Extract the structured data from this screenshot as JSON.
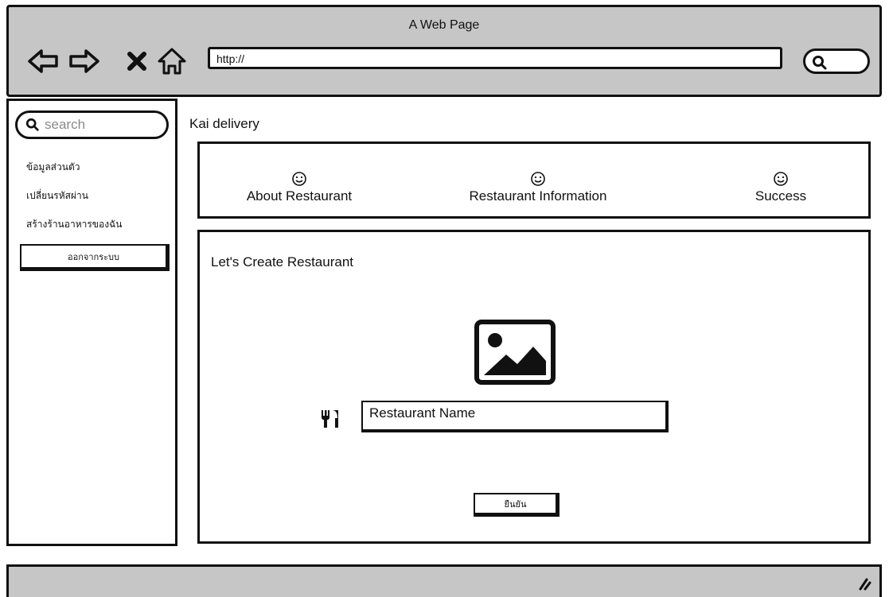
{
  "browser": {
    "title": "A Web Page",
    "url": "http://",
    "nav_icons": [
      "back-arrow-icon",
      "forward-arrow-icon",
      "stop-x-icon",
      "home-icon"
    ]
  },
  "sidebar": {
    "search_placeholder": "search",
    "items": [
      {
        "label": "ข้อมูลส่วนตัว"
      },
      {
        "label": "เปลี่ยนรหัสผ่าน"
      },
      {
        "label": "สร้างร้านอาหารของฉัน"
      }
    ],
    "logout_label": "ออกจากระบบ"
  },
  "main": {
    "app_title": "Kai delivery",
    "steps": [
      {
        "label": "About Restaurant",
        "icon": "smiley-icon"
      },
      {
        "label": "Restaurant Information",
        "icon": "smiley-icon"
      },
      {
        "label": "Success",
        "icon": "smiley-icon"
      }
    ],
    "form": {
      "heading": "Let's Create Restaurant",
      "image_icon": "image-placeholder-icon",
      "field_icon": "fork-knife-icon",
      "name_value": "Restaurant Name",
      "confirm_label": "ยืนยัน"
    }
  },
  "colors": {
    "chrome_gray": "#c6c6c6",
    "outline": "#111111",
    "placeholder_gray": "#8a8a8a"
  }
}
